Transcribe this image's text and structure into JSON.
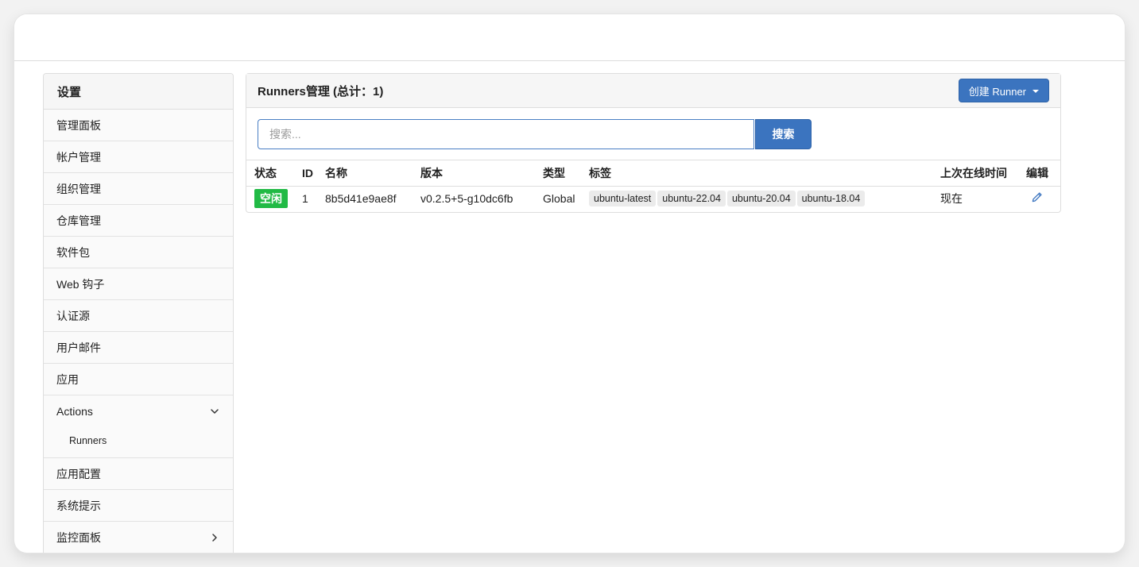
{
  "sidebar": {
    "header": "设置",
    "items": [
      {
        "label": "管理面板"
      },
      {
        "label": "帐户管理"
      },
      {
        "label": "组织管理"
      },
      {
        "label": "仓库管理"
      },
      {
        "label": "软件包"
      },
      {
        "label": "Web 钩子"
      },
      {
        "label": "认证源"
      },
      {
        "label": "用户邮件"
      },
      {
        "label": "应用"
      }
    ],
    "actions_group": {
      "label": "Actions",
      "sub_items": [
        {
          "label": "Runners"
        }
      ]
    },
    "items_after": [
      {
        "label": "应用配置"
      },
      {
        "label": "系统提示"
      },
      {
        "label": "监控面板"
      }
    ]
  },
  "panel": {
    "title": "Runners管理 (总计：1)",
    "create_button_label": "创建 Runner",
    "search": {
      "placeholder": "搜索...",
      "value": "",
      "button_label": "搜索"
    },
    "table": {
      "columns": [
        "状态",
        "ID",
        "名称",
        "版本",
        "类型",
        "标签",
        "上次在线时间",
        "编辑"
      ],
      "rows": [
        {
          "status": "空闲",
          "id": "1",
          "name": "8b5d41e9ae8f",
          "version": "v0.2.5+5-g10dc6fb",
          "type": "Global",
          "tags": [
            "ubuntu-latest",
            "ubuntu-22.04",
            "ubuntu-20.04",
            "ubuntu-18.04"
          ],
          "last_online": "现在"
        }
      ]
    }
  },
  "colors": {
    "primary": "#3b74bf",
    "status_idle": "#21ba45",
    "tag_bg": "#ebebeb"
  }
}
